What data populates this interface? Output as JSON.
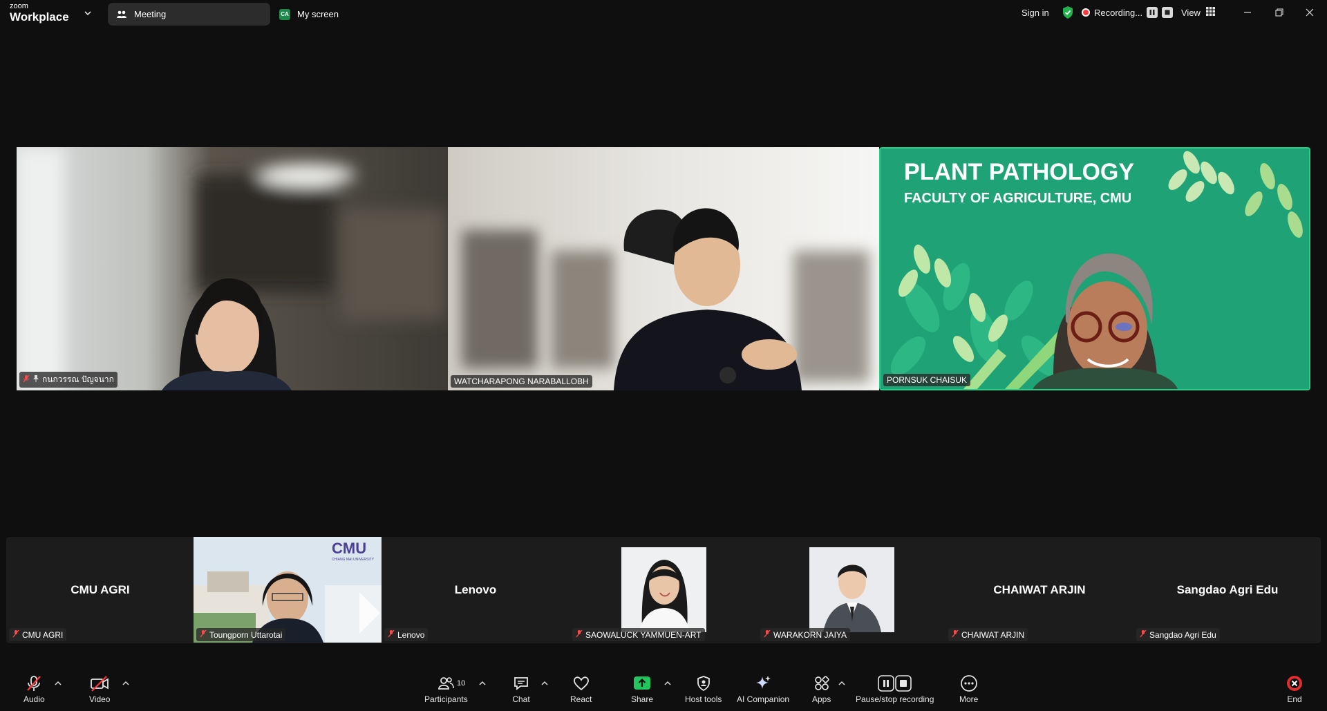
{
  "app": {
    "logo_top": "zoom",
    "logo_bottom": "Workplace"
  },
  "tabs": [
    {
      "label": "Meeting",
      "icon": "meeting-icon"
    },
    {
      "label": "My screen",
      "badge": "CA"
    }
  ],
  "titlebar": {
    "sign_in": "Sign in",
    "recording_label": "Recording...",
    "view_label": "View"
  },
  "speakers": [
    {
      "name": "กนกวรรณ ปัญจนาก",
      "muted": true,
      "pinned": true
    },
    {
      "name": "WATCHARAPONG NARABALLOBH",
      "muted": false
    },
    {
      "name": "PORNSUK CHAISUK",
      "muted": false,
      "active": true,
      "bg_title": "PLANT PATHOLOGY",
      "bg_subtitle": "FACULTY OF AGRICULTURE, CMU"
    }
  ],
  "gallery": [
    {
      "display": "CMU AGRI",
      "name": "CMU AGRI",
      "video": false
    },
    {
      "display": "",
      "name": "Toungporn Uttarotai",
      "video": true,
      "bg_logo": "CMU",
      "bg_logo_sub": "CHIANG MAI UNIVERSITY"
    },
    {
      "display": "Lenovo",
      "name": "Lenovo",
      "video": false
    },
    {
      "display": "",
      "name": "SAOWALUCK YAMMUEN-ART",
      "video": true
    },
    {
      "display": "",
      "name": "WARAKORN JAIYA",
      "video": true
    },
    {
      "display": "CHAIWAT ARJIN",
      "name": "CHAIWAT ARJIN",
      "video": false
    },
    {
      "display": "Sangdao Agri Edu",
      "name": "Sangdao Agri Edu",
      "video": false
    }
  ],
  "toolbar": {
    "audio": "Audio",
    "video": "Video",
    "participants": "Participants",
    "participants_count": "10",
    "chat": "Chat",
    "react": "React",
    "share": "Share",
    "host_tools": "Host tools",
    "ai_companion": "AI Companion",
    "apps": "Apps",
    "pause_stop": "Pause/stop recording",
    "more": "More",
    "end": "End"
  },
  "colors": {
    "accent_green": "#23d18b",
    "end_red": "#e02d2d",
    "share_green": "#22c55e"
  }
}
